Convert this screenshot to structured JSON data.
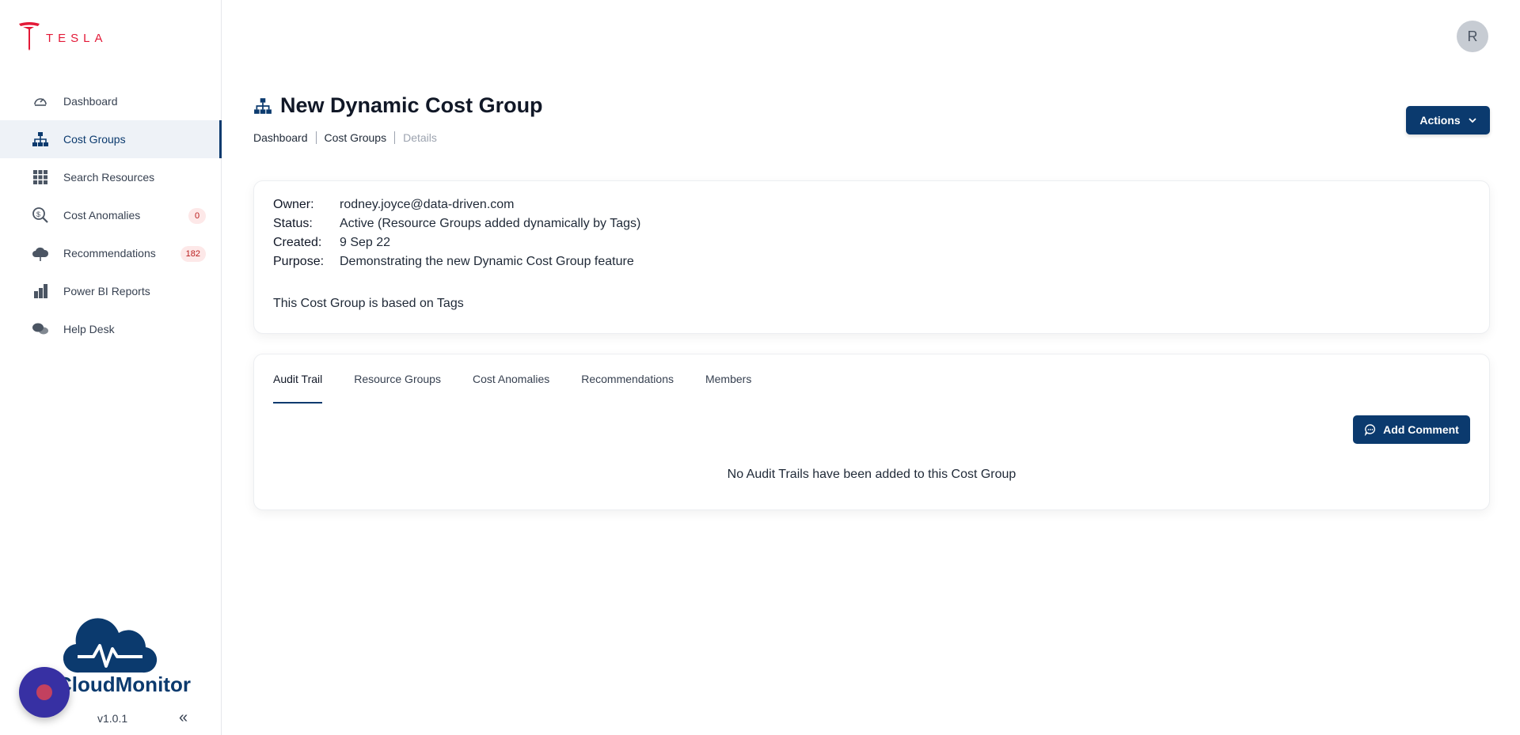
{
  "brand": {
    "logo_text": "TESLA",
    "app_name": "CloudMonitor",
    "version": "v1.0.1"
  },
  "sidebar": {
    "items": [
      {
        "label": "Dashboard",
        "icon": "gauge-icon"
      },
      {
        "label": "Cost Groups",
        "icon": "hierarchy-icon",
        "active": true
      },
      {
        "label": "Search Resources",
        "icon": "grid-icon"
      },
      {
        "label": "Cost Anomalies",
        "icon": "search-dollar-icon",
        "badge": "0"
      },
      {
        "label": "Recommendations",
        "icon": "cloud-icon",
        "badge": "182"
      },
      {
        "label": "Power BI Reports",
        "icon": "chart-icon"
      },
      {
        "label": "Help Desk",
        "icon": "chat-icon"
      }
    ],
    "collapse_glyph": "«"
  },
  "header": {
    "avatar_initial": "R"
  },
  "page": {
    "title": "New Dynamic Cost Group",
    "actions_label": "Actions",
    "breadcrumb": [
      "Dashboard",
      "Cost Groups",
      "Details"
    ]
  },
  "details": {
    "owner_label": "Owner:",
    "owner": "rodney.joyce@data-driven.com",
    "status_label": "Status:",
    "status": "Active (Resource Groups added dynamically by Tags)",
    "created_label": "Created:",
    "created": "9 Sep 22",
    "purpose_label": "Purpose:",
    "purpose": "Demonstrating the new Dynamic Cost Group feature",
    "basis": "This Cost Group is based on Tags"
  },
  "tabs": {
    "items": [
      "Audit Trail",
      "Resource Groups",
      "Cost Anomalies",
      "Recommendations",
      "Members"
    ],
    "active": "Audit Trail",
    "add_comment_label": "Add Comment",
    "empty_message": "No Audit Trails have been added to this Cost Group"
  },
  "colors": {
    "primary": "#0b3a6e",
    "tesla_red": "#e31937",
    "badge_bg": "#fde8e8",
    "badge_text": "#b91c1c",
    "fab": "#3730a3"
  }
}
